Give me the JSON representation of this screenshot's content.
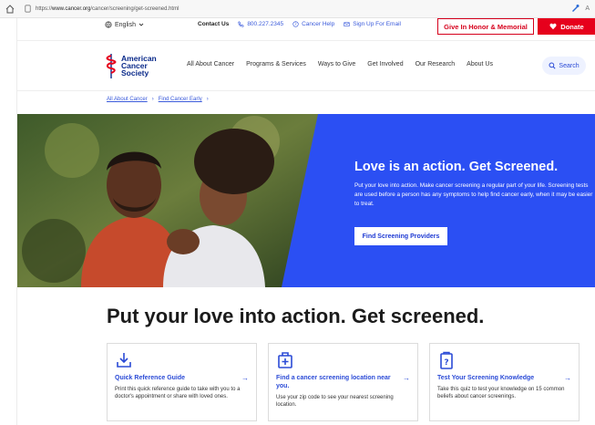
{
  "browser": {
    "url_prefix": "https://",
    "url_domain": "www.cancer.org",
    "url_path": "/cancer/screening/get-screened.html",
    "right_text": "A"
  },
  "utility": {
    "language": "English",
    "contact_label": "Contact Us",
    "phone": "800.227.2345",
    "cancer_help": "Cancer Help",
    "sign_up": "Sign Up For Email",
    "honor_button": "Give In Honor & Memorial",
    "donate_button": "Donate"
  },
  "logo": {
    "line1": "American",
    "line2": "Cancer",
    "line3": "Society"
  },
  "nav": {
    "items": [
      "All About Cancer",
      "Programs & Services",
      "Ways to Give",
      "Get Involved",
      "Our Research",
      "About Us"
    ],
    "search": "Search"
  },
  "breadcrumb": [
    "All About Cancer",
    "Find Cancer Early"
  ],
  "hero": {
    "title": "Love is an action. Get Screened.",
    "text": "Put your love into action. Make cancer screening a regular part of your life. Screening tests are used before a person has any symptoms to help find cancer early, when it may be easier to treat.",
    "button": "Find Screening Providers"
  },
  "section": {
    "title": "Put your love into action. Get screened."
  },
  "cards": [
    {
      "title": "Quick Reference Guide",
      "desc": "Print this quick reference guide to take with you to a doctor's appointment or share with loved ones.",
      "icon": "download-icon"
    },
    {
      "title": "Find a cancer screening location near you.",
      "desc": "Use your zip code to see your nearest screening location.",
      "icon": "hospital-icon"
    },
    {
      "title": "Test Your Screening Knowledge",
      "desc": "Take this quiz to test your knowledge on 15 common beliefs about cancer screenings.",
      "icon": "quiz-icon"
    }
  ],
  "colors": {
    "brand_blue": "#2b4ff3",
    "red": "#e6001c",
    "link": "#2b4bd6"
  }
}
